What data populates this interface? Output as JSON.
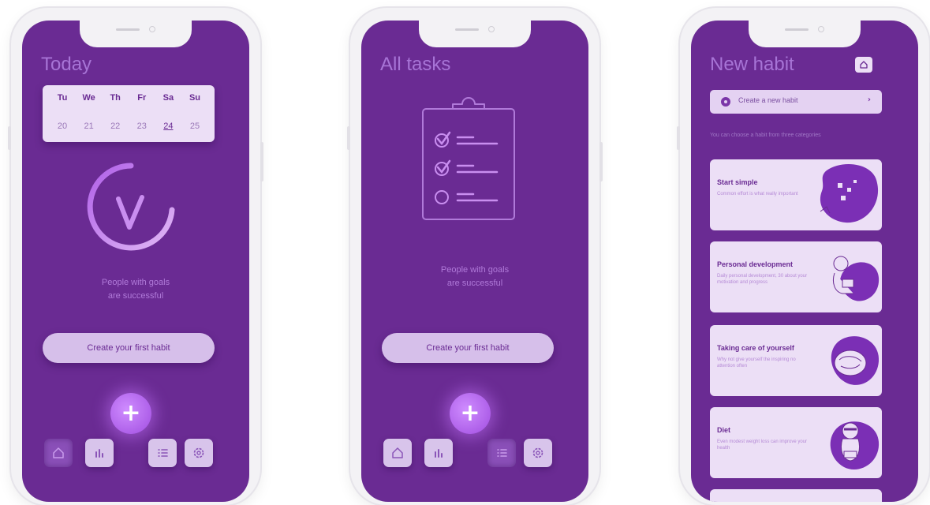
{
  "screens": {
    "today": {
      "title": "Today",
      "weekdays": [
        "Tu",
        "We",
        "Th",
        "Fr",
        "Sa",
        "Su"
      ],
      "dates": [
        "20",
        "21",
        "22",
        "23",
        "24",
        "25"
      ],
      "selected_date": "24",
      "tagline_line1": "People with goals",
      "tagline_line2": "are successful",
      "create_button": "Create your first habit",
      "fab_label": "+"
    },
    "all_tasks": {
      "title": "All tasks",
      "tagline_line1": "People with goals",
      "tagline_line2": "are successful",
      "create_button": "Create your first habit",
      "fab_label": "+"
    },
    "new_habit": {
      "title": "New habit",
      "create_row_label": "Create a new habit",
      "intro": "You can choose a habit from three categories",
      "cards": [
        {
          "title": "Start simple",
          "desc": "Common effort is what really important",
          "icon": "paper-blob-illustration"
        },
        {
          "title": "Personal development",
          "desc": "Daily personal development, 30 about your motivation and progress",
          "icon": "woman-reading-illustration"
        },
        {
          "title": "Taking care of yourself",
          "desc": "Why not give yourself the inspiring no attention often",
          "icon": "bowl-food-illustration"
        },
        {
          "title": "Diet",
          "desc": "Even modest weight loss can improve your health",
          "icon": "raccoon-eating-illustration"
        }
      ]
    }
  },
  "nav": {
    "items": [
      "home-icon",
      "stats-icon",
      "list-icon",
      "settings-icon"
    ]
  },
  "colors": {
    "screen_bg": "#6a2b93",
    "accent": "#a04de0",
    "card_bg": "#ecdff6",
    "frame": "#f3f2f5"
  }
}
